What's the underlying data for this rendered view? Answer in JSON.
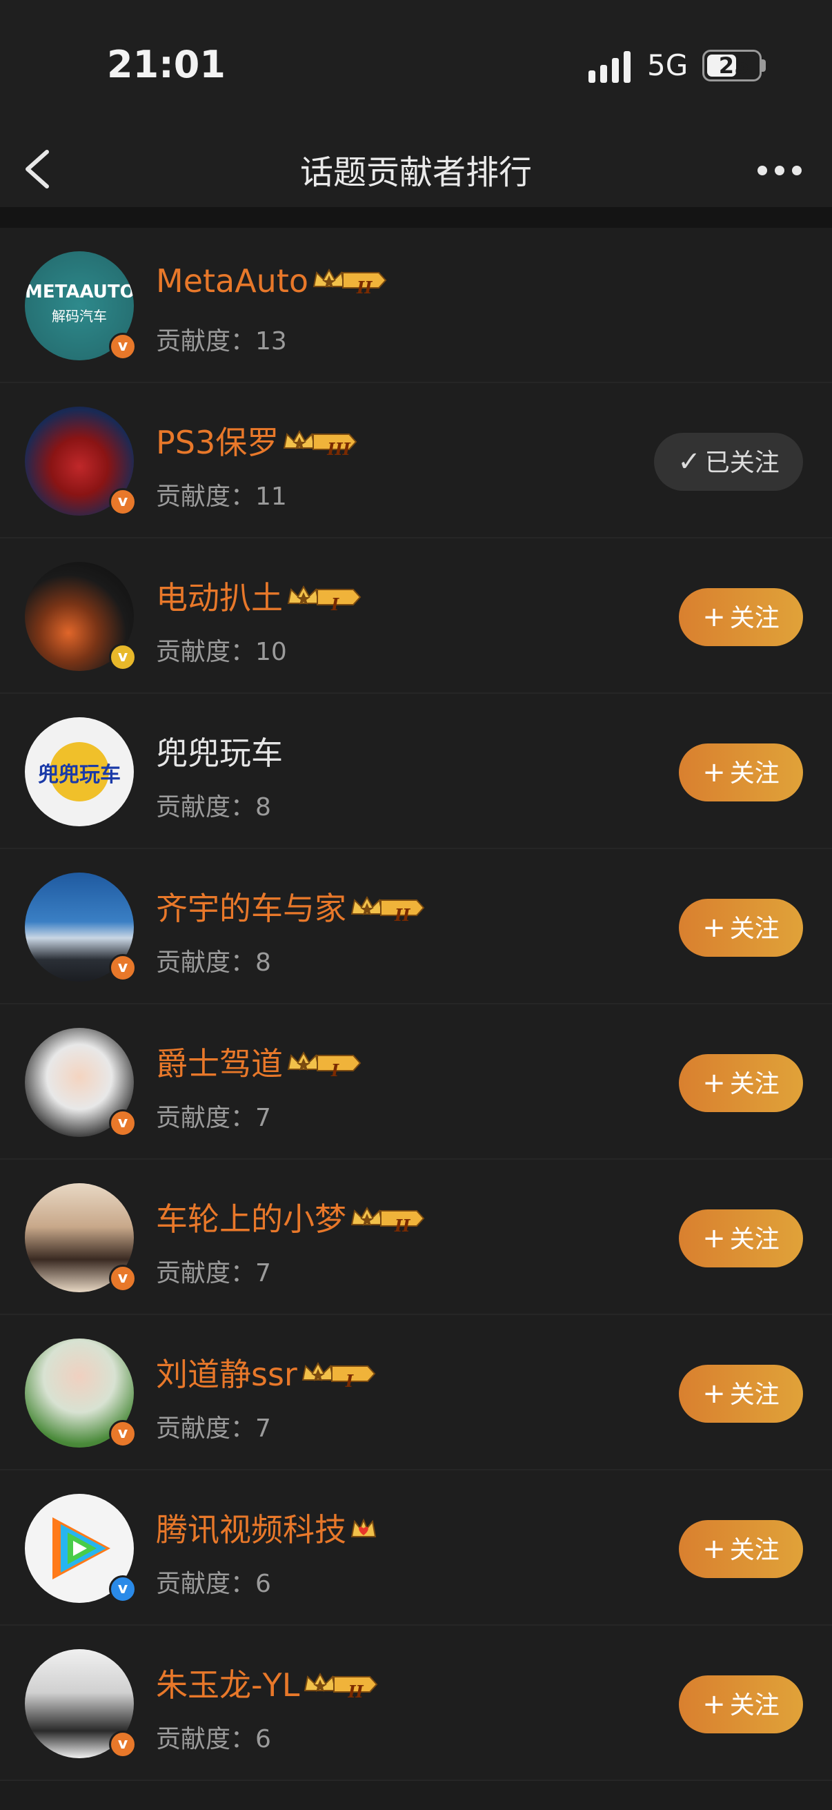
{
  "status": {
    "time": "21:01",
    "network": "5G",
    "battery": "25"
  },
  "nav": {
    "title": "话题贡献者排行"
  },
  "rows": [
    {
      "name": "MetaAuto",
      "score_label": "贡献度：",
      "score": "13",
      "button": "",
      "avatar_text": "METAAUTO",
      "avatar_sub": "解码汽车",
      "rank": "II",
      "badge_color": "#e8782a"
    },
    {
      "name": "PS3保罗",
      "score_label": "贡献度：",
      "score": "11",
      "button": "已关注",
      "rank": "III",
      "badge_color": "#e8782a"
    },
    {
      "name": "电动扒土",
      "score_label": "贡献度：",
      "score": "10",
      "button": "关注",
      "rank": "I",
      "badge_color": "#e8b82a"
    },
    {
      "name": "兜兜玩车",
      "score_label": "贡献度：",
      "score": "8",
      "button": "关注",
      "avatar_text": "兜兜玩车"
    },
    {
      "name": "齐宇的车与家",
      "score_label": "贡献度：",
      "score": "8",
      "button": "关注",
      "rank": "II",
      "badge_color": "#e8782a"
    },
    {
      "name": "爵士驾道",
      "score_label": "贡献度：",
      "score": "7",
      "button": "关注",
      "rank": "I",
      "badge_color": "#e8782a"
    },
    {
      "name": "车轮上的小梦",
      "score_label": "贡献度：",
      "score": "7",
      "button": "关注",
      "rank": "II",
      "badge_color": "#e8782a"
    },
    {
      "name": "刘道静ssr",
      "score_label": "贡献度：",
      "score": "7",
      "button": "关注",
      "rank": "I",
      "badge_color": "#e8782a"
    },
    {
      "name": "腾讯视频科技",
      "score_label": "贡献度：",
      "score": "6",
      "button": "关注",
      "badge_color": "#2a8ae8"
    },
    {
      "name": "朱玉龙-YL",
      "score_label": "贡献度：",
      "score": "6",
      "button": "关注",
      "rank": "II",
      "badge_color": "#e8782a"
    }
  ]
}
